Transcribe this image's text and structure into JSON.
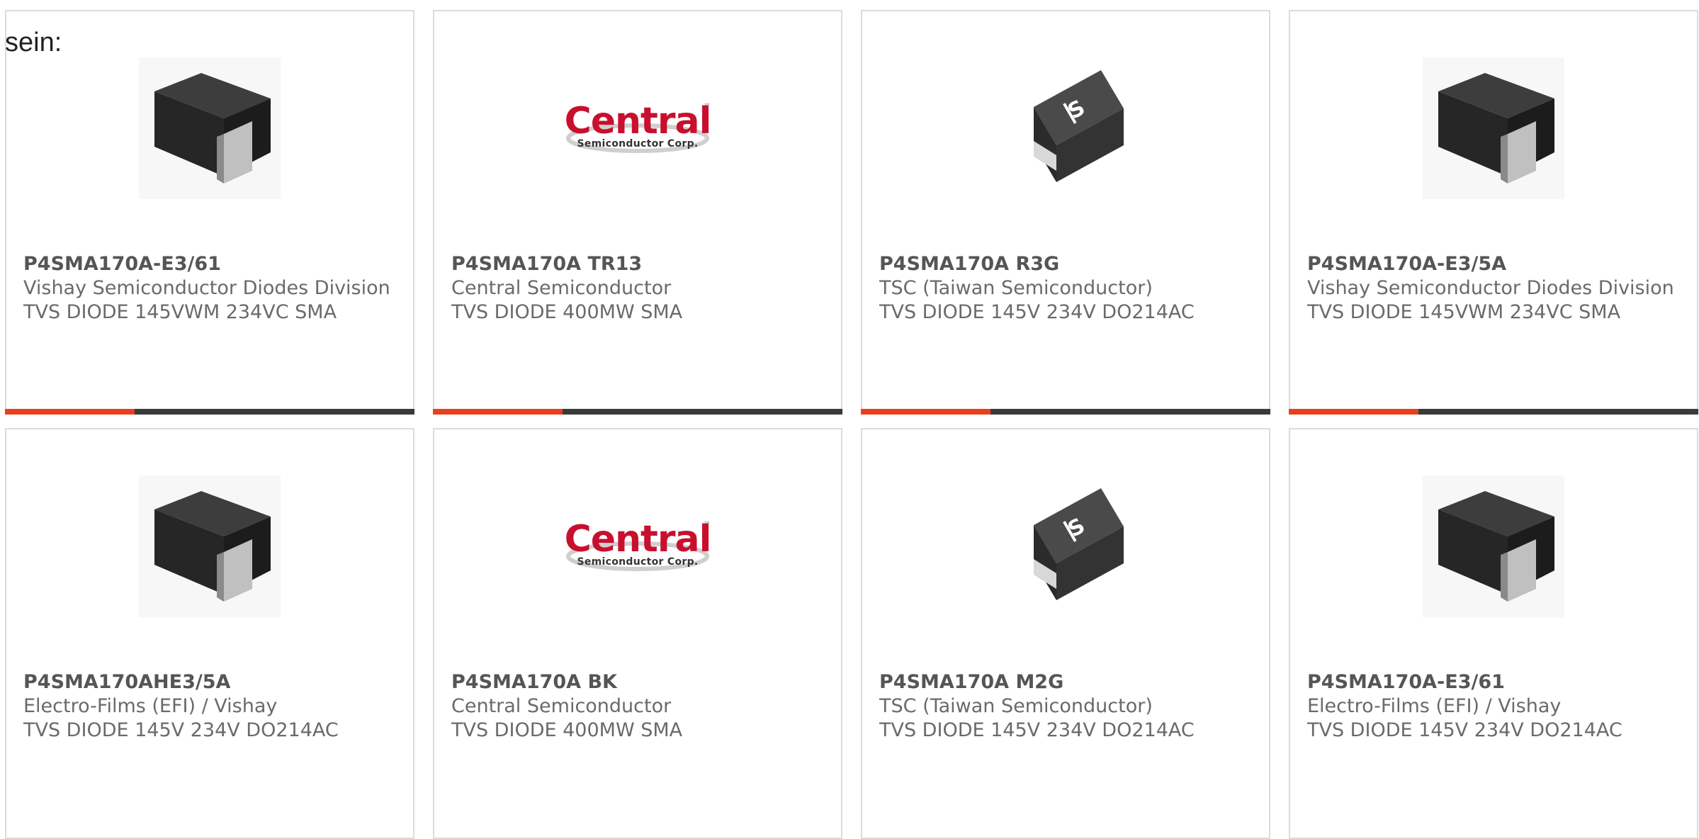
{
  "intro_text": "sein:",
  "colors": {
    "accent": "#e8401c",
    "bar": "#3a3a3a",
    "border": "#dcdcdc",
    "central_red": "#c8102e"
  },
  "logos": {
    "central_word": "Central",
    "central_sub": "Semiconductor Corp.",
    "central_tm": "™"
  },
  "products": [
    {
      "part_number": "P4SMA170A-E3/61",
      "manufacturer": "Vishay Semiconductor Diodes Division",
      "description": "TVS DIODE 145VWM 234VC SMA",
      "image": "sma-package-black"
    },
    {
      "part_number": "P4SMA170A TR13",
      "manufacturer": "Central Semiconductor",
      "description": "TVS DIODE 400MW SMA",
      "image": "central-logo"
    },
    {
      "part_number": "P4SMA170A R3G",
      "manufacturer": "TSC (Taiwan Semiconductor)",
      "description": "TVS DIODE 145V 234V DO214AC",
      "image": "tsc-diode"
    },
    {
      "part_number": "P4SMA170A-E3/5A",
      "manufacturer": "Vishay Semiconductor Diodes Division",
      "description": "TVS DIODE 145VWM 234VC SMA",
      "image": "sma-package-black"
    },
    {
      "part_number": "P4SMA170AHE3/5A",
      "manufacturer": "Electro-Films (EFI) / Vishay",
      "description": "TVS DIODE 145V 234V DO214AC",
      "image": "sma-package-black"
    },
    {
      "part_number": "P4SMA170A BK",
      "manufacturer": "Central Semiconductor",
      "description": "TVS DIODE 400MW SMA",
      "image": "central-logo"
    },
    {
      "part_number": "P4SMA170A M2G",
      "manufacturer": "TSC (Taiwan Semiconductor)",
      "description": "TVS DIODE 145V 234V DO214AC",
      "image": "tsc-diode"
    },
    {
      "part_number": "P4SMA170A-E3/61",
      "manufacturer": "Electro-Films (EFI) / Vishay",
      "description": "TVS DIODE 145V 234V DO214AC",
      "image": "sma-package-black"
    }
  ]
}
